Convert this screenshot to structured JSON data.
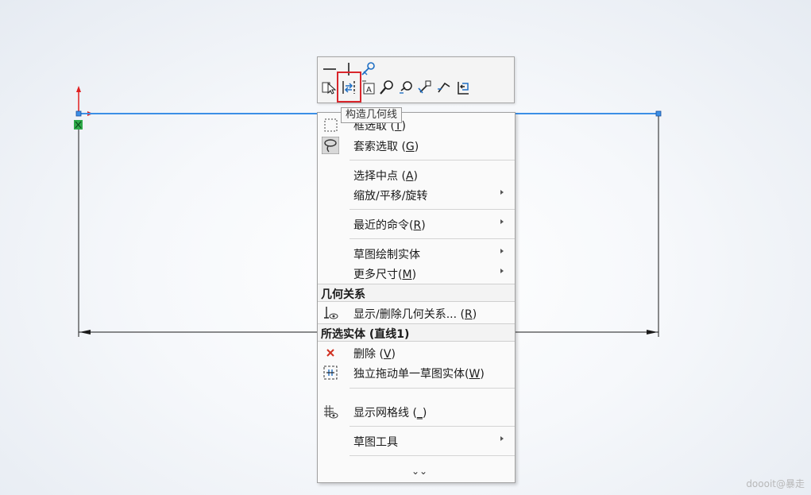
{
  "toolbar": {
    "row1": [
      "horizontal-line-icon",
      "vertical-line-icon",
      "fix-constraint-icon"
    ],
    "row2": [
      "select-other-icon",
      "construction-geometry-icon",
      "smart-dimension-icon",
      "zoom-selection-icon",
      "hide-show-icon",
      "relation-icon",
      "trim-icon",
      "exit-sketch-icon"
    ],
    "tooltip": "构造几何线",
    "highlight_color": "#d9262c"
  },
  "menu": {
    "box_select": {
      "label": "框选取",
      "shortcut": "T"
    },
    "lasso_select": {
      "label": "套索选取",
      "shortcut": "G"
    },
    "select_midpoint": {
      "label": "选择中点",
      "shortcut": "A"
    },
    "zoom_pan_rotate": {
      "label": "缩放/平移/旋转"
    },
    "recent_commands": {
      "label": "最近的命令",
      "shortcut": "R"
    },
    "sketch_entities": {
      "label": "草图绘制实体"
    },
    "more_dimensions": {
      "label": "更多尺寸",
      "shortcut": "M"
    },
    "relations_header": "几何关系",
    "show_delete_relations": {
      "label": "显示/删除几何关系...",
      "shortcut": "R"
    },
    "selected_header": "所选实体 (直线1)",
    "delete": {
      "label": "删除",
      "shortcut": "V"
    },
    "drag_entity": {
      "label": "独立拖动单一草图实体",
      "shortcut": "W"
    },
    "show_grid": {
      "label": "显示网格线",
      "shortcut": "_"
    },
    "sketch_tools": {
      "label": "草图工具"
    },
    "expand": "⌄⌄"
  },
  "colors": {
    "selected_line": "#3c8fe6",
    "sketch_line": "#1a1a1a",
    "origin_red": "#e02020",
    "origin_green": "#2eaa4a",
    "delete_red": "#d03020"
  },
  "watermark": "doooit@暴走"
}
